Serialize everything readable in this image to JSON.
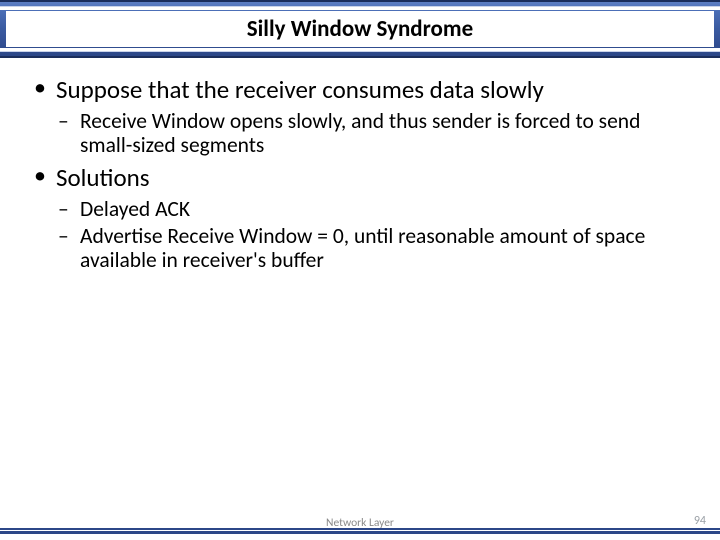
{
  "title": "Silly Window Syndrome",
  "bullets": {
    "b1": "Suppose that the receiver consumes data slowly",
    "b1_sub1": "Receive Window opens slowly, and thus sender is forced to send small-sized segments",
    "b2": "Solutions",
    "b2_sub1": "Delayed ACK",
    "b2_sub2": "Advertise Receive Window = 0, until reasonable amount of space available in receiver's buffer"
  },
  "footer": {
    "section": "Network Layer",
    "page": "94"
  }
}
